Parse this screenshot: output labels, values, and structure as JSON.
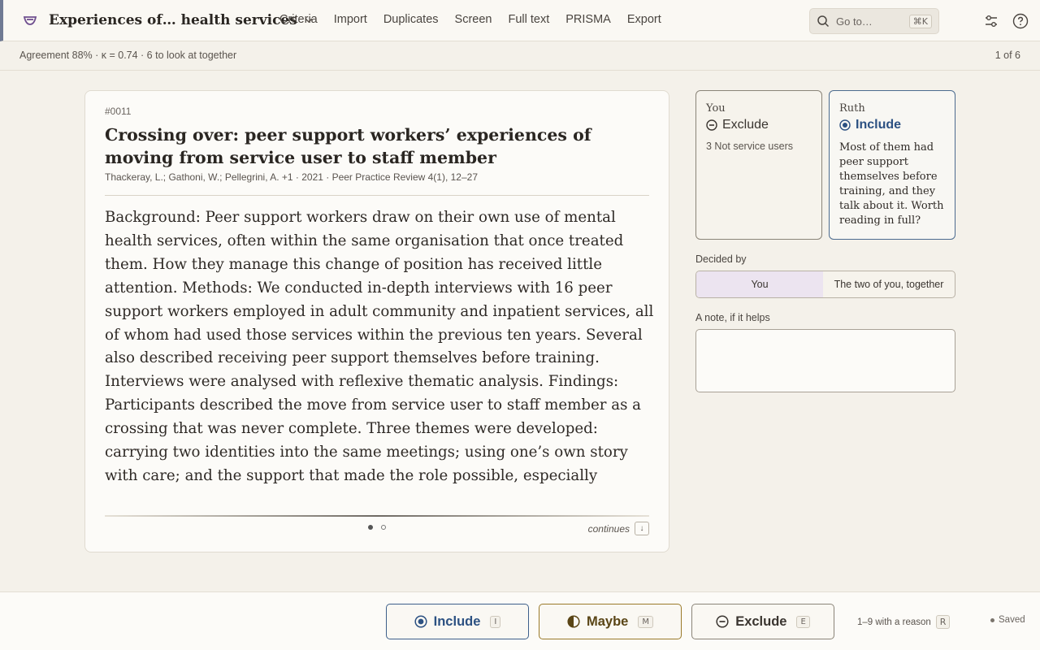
{
  "header": {
    "project_title": "Experiences of… health services",
    "nav": [
      "Criteria",
      "Import",
      "Duplicates",
      "Screen",
      "Full text",
      "PRISMA",
      "Export"
    ],
    "search_placeholder": "Go to…",
    "search_shortcut": "⌘K"
  },
  "status": {
    "agreement": "Agreement 88% · κ = 0.74 · 6 to look at together",
    "position": "1 of 6"
  },
  "record": {
    "id": "#0011",
    "title": "Crossing over: peer support workers’ experiences of moving from service user to staff member",
    "meta": "Thackeray, L.; Gathoni, W.; Pellegrini, A. +1 · 2021 · Peer Practice Review 4(1), 12–27",
    "abstract": "Background: Peer support workers draw on their own use of mental health services, often within the same organisation that once treated them. How they manage this change of position has received little attention. Methods: We conducted in-depth interviews with 16 peer support workers employed in adult community and inpatient services, all of whom had used those services within the previous ten years. Several also described receiving peer support themselves before training. Interviews were analysed with reflexive thematic analysis. Findings: Participants described the move from service user to staff member as a crossing that was never complete. Three themes were developed: carrying two identities into the same meetings; using one’s own story with care; and the support that made the role possible, especially supervision from other peer workers. Participants who had once received peer support said it",
    "continues_label": "continues"
  },
  "decisions": {
    "you": {
      "name": "You",
      "decision": "Exclude",
      "reason": "3 Not service users"
    },
    "ruth": {
      "name": "Ruth",
      "decision": "Include",
      "note": "Most of them had peer support themselves before training, and they talk about it. Worth reading in full?"
    }
  },
  "decided_by": {
    "label": "Decided by",
    "options": [
      "You",
      "The two of you, together"
    ],
    "selected": "You"
  },
  "note": {
    "label": "A note, if it helps",
    "value": ""
  },
  "actions": {
    "include": {
      "label": "Include",
      "key": "I"
    },
    "maybe": {
      "label": "Maybe",
      "key": "M"
    },
    "exclude": {
      "label": "Exclude",
      "key": "E"
    },
    "reason_hint": "1–9 with a reason",
    "reason_key": "R",
    "saved": "Saved"
  },
  "colors": {
    "include": "#2c5182",
    "maybe": "#9a7a2a",
    "accent": "#6f4f8f"
  }
}
